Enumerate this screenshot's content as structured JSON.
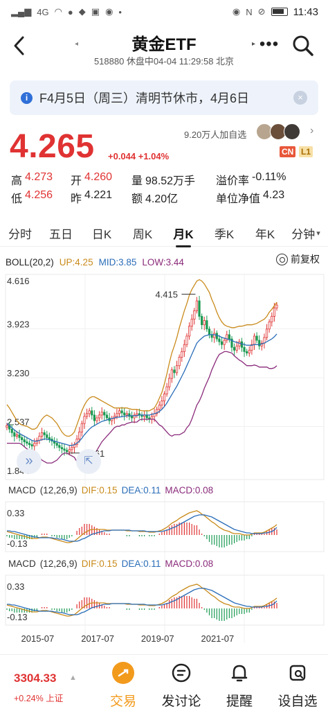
{
  "status_bar": {
    "signal": "4G",
    "time": "11:43"
  },
  "header": {
    "title": "黄金ETF",
    "subtitle": "518880 休盘中04-04 11:29:58 北京",
    "more": "•••"
  },
  "notice": {
    "text": "F4月5日（周三）清明节休市，4月6日"
  },
  "quote": {
    "price": "4.265",
    "change": "+0.044 +1.04%",
    "followers": "9.20万人加自选",
    "badge_cn": "CN",
    "badge_l1": "L1",
    "stats": [
      [
        {
          "k": "高",
          "v": "4.273",
          "c": "red"
        },
        {
          "k": "开",
          "v": "4.260",
          "c": "red"
        },
        {
          "k": "量",
          "v": "98.52万手",
          "c": ""
        },
        {
          "k": "溢价率",
          "v": "-0.11%",
          "c": ""
        }
      ],
      [
        {
          "k": "低",
          "v": "4.256",
          "c": "red"
        },
        {
          "k": "昨",
          "v": "4.221",
          "c": ""
        },
        {
          "k": "额",
          "v": "4.20亿",
          "c": ""
        },
        {
          "k": "单位净值",
          "v": "4.23",
          "c": ""
        }
      ]
    ]
  },
  "tabs": [
    {
      "label": "分时",
      "active": false
    },
    {
      "label": "五日",
      "active": false
    },
    {
      "label": "日K",
      "active": false
    },
    {
      "label": "周K",
      "active": false
    },
    {
      "label": "月K",
      "active": true
    },
    {
      "label": "季K",
      "active": false
    },
    {
      "label": "年K",
      "active": false
    },
    {
      "label": "分钟",
      "active": false
    }
  ],
  "indicator": {
    "name": "BOLL(20,2)",
    "up": "UP:4.25",
    "mid": "MID:3.85",
    "low": "LOW:3.44",
    "adjust": "前复权"
  },
  "macd_panels": [
    {
      "name": "MACD",
      "params": "(12,26,9)",
      "dif": "DIF:0.15",
      "dea": "DEA:0.11",
      "macd": "MACD:0.08"
    },
    {
      "name": "MACD",
      "params": "(12,26,9)",
      "dif": "DIF:0.15",
      "dea": "DEA:0.11",
      "macd": "MACD:0.08"
    }
  ],
  "chart_data": {
    "type": "candlestick",
    "main": {
      "y_ticks": [
        "4.616",
        "3.923",
        "3.230",
        "2.537",
        "1.844"
      ],
      "ylim": [
        1.844,
        4.616
      ],
      "max_label": "4.415",
      "min_label": "2.161",
      "x_ticks": [
        "2015-07",
        "2017-07",
        "2019-07",
        "2021-07"
      ],
      "close": [
        2.55,
        2.5,
        2.45,
        2.4,
        2.42,
        2.38,
        2.35,
        2.32,
        2.3,
        2.28,
        2.26,
        2.3,
        2.34,
        2.4,
        2.45,
        2.42,
        2.38,
        2.36,
        2.33,
        2.3,
        2.27,
        2.24,
        2.22,
        2.2,
        2.18,
        2.21,
        2.24,
        2.28,
        2.36,
        2.46,
        2.58,
        2.68,
        2.72,
        2.76,
        2.7,
        2.62,
        2.66,
        2.7,
        2.74,
        2.7,
        2.66,
        2.62,
        2.65,
        2.68,
        2.72,
        2.76,
        2.73,
        2.7,
        2.72,
        2.68,
        2.66,
        2.7,
        2.72,
        2.7,
        2.68,
        2.7,
        2.66,
        2.64,
        2.68,
        2.72,
        2.78,
        2.84,
        2.9,
        3.0,
        3.1,
        3.22,
        3.34,
        3.3,
        3.4,
        3.52,
        3.6,
        3.7,
        3.82,
        3.96,
        4.06,
        4.18,
        4.32,
        4.1,
        3.98,
        4.04,
        3.92,
        3.84,
        3.8,
        3.86,
        3.78,
        3.74,
        3.7,
        3.76,
        3.84,
        3.78,
        3.66,
        3.62,
        3.68,
        3.74,
        3.66,
        3.6,
        3.58,
        3.62,
        3.7,
        3.82,
        3.76,
        3.68,
        3.72,
        3.8,
        3.92,
        4.02,
        4.1,
        4.22,
        4.26
      ],
      "boll_up": [
        2.85,
        2.8,
        2.74,
        2.68,
        2.62,
        2.58,
        2.56,
        2.55,
        2.54,
        2.52,
        2.5,
        2.5,
        2.52,
        2.58,
        2.64,
        2.68,
        2.7,
        2.68,
        2.66,
        2.62,
        2.58,
        2.52,
        2.46,
        2.42,
        2.4,
        2.4,
        2.42,
        2.46,
        2.56,
        2.66,
        2.76,
        2.84,
        2.9,
        2.94,
        2.96,
        2.96,
        2.94,
        2.92,
        2.9,
        2.88,
        2.86,
        2.84,
        2.82,
        2.8,
        2.8,
        2.8,
        2.8,
        2.8,
        2.8,
        2.79,
        2.78,
        2.78,
        2.78,
        2.77,
        2.76,
        2.76,
        2.76,
        2.76,
        2.78,
        2.8,
        2.86,
        2.94,
        3.02,
        3.14,
        3.28,
        3.44,
        3.58,
        3.68,
        3.8,
        3.94,
        4.06,
        4.18,
        4.28,
        4.4,
        4.48,
        4.54,
        4.6,
        4.62,
        4.6,
        4.56,
        4.5,
        4.44,
        4.34,
        4.26,
        4.16,
        4.08,
        4.02,
        3.98,
        3.96,
        3.95,
        3.94,
        3.94,
        3.95,
        3.96,
        3.96,
        3.97,
        3.98,
        3.98,
        3.98,
        3.99,
        4.0,
        4.02,
        4.04,
        4.06,
        4.1,
        4.16,
        4.2,
        4.25,
        4.3
      ],
      "boll_mid": [
        2.58,
        2.55,
        2.52,
        2.49,
        2.46,
        2.44,
        2.42,
        2.4,
        2.38,
        2.36,
        2.34,
        2.33,
        2.33,
        2.34,
        2.35,
        2.36,
        2.36,
        2.35,
        2.34,
        2.33,
        2.32,
        2.31,
        2.3,
        2.29,
        2.28,
        2.27,
        2.27,
        2.28,
        2.3,
        2.33,
        2.37,
        2.42,
        2.46,
        2.5,
        2.53,
        2.55,
        2.57,
        2.59,
        2.61,
        2.62,
        2.63,
        2.64,
        2.65,
        2.66,
        2.67,
        2.67,
        2.68,
        2.68,
        2.69,
        2.69,
        2.69,
        2.69,
        2.69,
        2.7,
        2.7,
        2.7,
        2.7,
        2.7,
        2.71,
        2.72,
        2.73,
        2.75,
        2.78,
        2.82,
        2.87,
        2.93,
        2.99,
        3.05,
        3.11,
        3.18,
        3.25,
        3.32,
        3.4,
        3.48,
        3.56,
        3.64,
        3.72,
        3.76,
        3.79,
        3.82,
        3.83,
        3.84,
        3.84,
        3.84,
        3.83,
        3.82,
        3.8,
        3.79,
        3.78,
        3.77,
        3.76,
        3.74,
        3.73,
        3.72,
        3.71,
        3.7,
        3.69,
        3.69,
        3.69,
        3.7,
        3.7,
        3.7,
        3.71,
        3.72,
        3.74,
        3.76,
        3.78,
        3.81,
        3.85
      ],
      "boll_low": [
        2.3,
        2.3,
        2.3,
        2.3,
        2.3,
        2.3,
        2.28,
        2.25,
        2.22,
        2.2,
        2.18,
        2.16,
        2.14,
        2.1,
        2.06,
        2.04,
        2.02,
        2.02,
        2.02,
        2.04,
        2.06,
        2.1,
        2.14,
        2.16,
        2.16,
        2.14,
        2.12,
        2.1,
        2.04,
        2.0,
        1.98,
        2.0,
        2.02,
        2.06,
        2.1,
        2.14,
        2.2,
        2.26,
        2.32,
        2.36,
        2.4,
        2.44,
        2.48,
        2.52,
        2.54,
        2.54,
        2.56,
        2.56,
        2.58,
        2.59,
        2.6,
        2.6,
        2.6,
        2.63,
        2.64,
        2.64,
        2.64,
        2.64,
        2.64,
        2.64,
        2.6,
        2.56,
        2.54,
        2.5,
        2.46,
        2.42,
        2.4,
        2.42,
        2.42,
        2.42,
        2.44,
        2.46,
        2.52,
        2.56,
        2.64,
        2.74,
        2.84,
        2.9,
        2.98,
        3.08,
        3.16,
        3.24,
        3.34,
        3.42,
        3.5,
        3.56,
        3.58,
        3.6,
        3.6,
        3.59,
        3.58,
        3.54,
        3.51,
        3.48,
        3.46,
        3.43,
        3.4,
        3.4,
        3.4,
        3.41,
        3.4,
        3.38,
        3.38,
        3.38,
        3.38,
        3.36,
        3.36,
        3.37,
        3.4
      ]
    },
    "macd": {
      "y_ticks": [
        "0.33",
        "-0.13"
      ],
      "ylim": [
        -0.2,
        0.4
      ],
      "dif": [
        0.05,
        0.04,
        0.03,
        0.02,
        0.01,
        0.0,
        -0.01,
        -0.02,
        -0.03,
        -0.04,
        -0.05,
        -0.05,
        -0.05,
        -0.04,
        -0.03,
        -0.03,
        -0.03,
        -0.04,
        -0.05,
        -0.06,
        -0.07,
        -0.08,
        -0.09,
        -0.1,
        -0.11,
        -0.11,
        -0.1,
        -0.09,
        -0.06,
        -0.03,
        0.0,
        0.03,
        0.05,
        0.07,
        0.08,
        0.08,
        0.08,
        0.08,
        0.08,
        0.08,
        0.07,
        0.07,
        0.07,
        0.07,
        0.07,
        0.07,
        0.07,
        0.07,
        0.06,
        0.06,
        0.06,
        0.06,
        0.06,
        0.05,
        0.05,
        0.05,
        0.05,
        0.04,
        0.04,
        0.04,
        0.05,
        0.06,
        0.07,
        0.09,
        0.11,
        0.14,
        0.17,
        0.19,
        0.21,
        0.24,
        0.26,
        0.28,
        0.3,
        0.32,
        0.33,
        0.34,
        0.35,
        0.33,
        0.3,
        0.28,
        0.25,
        0.22,
        0.19,
        0.17,
        0.14,
        0.11,
        0.09,
        0.07,
        0.06,
        0.05,
        0.03,
        0.02,
        0.02,
        0.02,
        0.01,
        0.0,
        0.0,
        0.0,
        0.01,
        0.03,
        0.03,
        0.03,
        0.03,
        0.04,
        0.06,
        0.08,
        0.1,
        0.12,
        0.15
      ],
      "dea": [
        0.06,
        0.06,
        0.05,
        0.05,
        0.04,
        0.03,
        0.02,
        0.01,
        0.0,
        -0.01,
        -0.02,
        -0.03,
        -0.03,
        -0.04,
        -0.04,
        -0.04,
        -0.04,
        -0.04,
        -0.04,
        -0.05,
        -0.05,
        -0.06,
        -0.06,
        -0.07,
        -0.08,
        -0.09,
        -0.09,
        -0.09,
        -0.09,
        -0.08,
        -0.06,
        -0.05,
        -0.03,
        -0.01,
        0.01,
        0.02,
        0.03,
        0.04,
        0.05,
        0.06,
        0.06,
        0.06,
        0.07,
        0.07,
        0.07,
        0.07,
        0.07,
        0.07,
        0.07,
        0.07,
        0.06,
        0.06,
        0.06,
        0.06,
        0.06,
        0.06,
        0.05,
        0.05,
        0.05,
        0.05,
        0.05,
        0.05,
        0.05,
        0.06,
        0.07,
        0.08,
        0.1,
        0.11,
        0.13,
        0.15,
        0.17,
        0.19,
        0.21,
        0.23,
        0.25,
        0.27,
        0.28,
        0.29,
        0.29,
        0.29,
        0.28,
        0.27,
        0.26,
        0.24,
        0.22,
        0.2,
        0.18,
        0.16,
        0.14,
        0.12,
        0.1,
        0.08,
        0.07,
        0.06,
        0.05,
        0.04,
        0.03,
        0.03,
        0.02,
        0.02,
        0.02,
        0.02,
        0.02,
        0.03,
        0.03,
        0.04,
        0.05,
        0.07,
        0.11
      ]
    }
  },
  "bottom": {
    "index_value": "3304.33",
    "index_change": "+0.24% 上证",
    "nav": [
      {
        "label": "交易",
        "icon": "trade-icon"
      },
      {
        "label": "发讨论",
        "icon": "comment-icon"
      },
      {
        "label": "提醒",
        "icon": "bell-icon"
      },
      {
        "label": "设自选",
        "icon": "watchlist-icon"
      }
    ]
  }
}
